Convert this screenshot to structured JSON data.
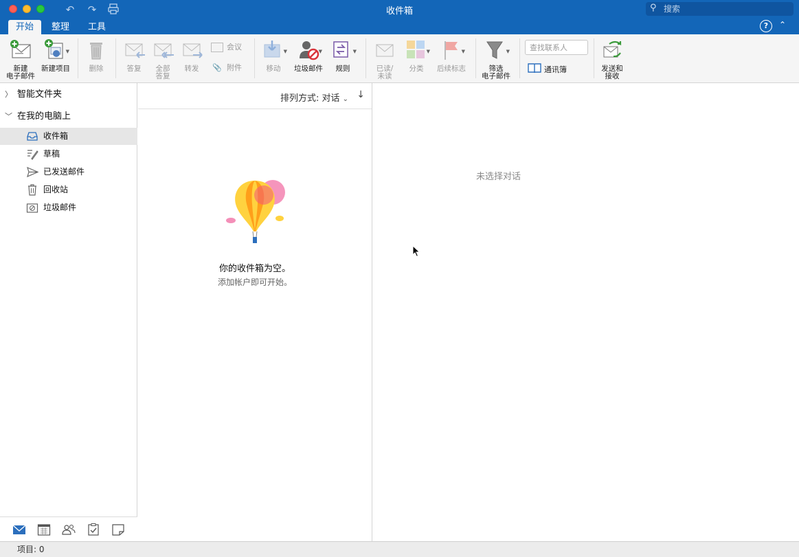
{
  "window": {
    "title": "收件箱",
    "search_placeholder": "搜索"
  },
  "tabs": [
    {
      "label": "开始",
      "active": true
    },
    {
      "label": "整理",
      "active": false
    },
    {
      "label": "工具",
      "active": false
    }
  ],
  "ribbon": {
    "new_email": {
      "line1": "新建",
      "line2": "电子邮件"
    },
    "new_item": "新建项目",
    "delete": "删除",
    "reply": "答复",
    "reply_all": {
      "line1": "全部",
      "line2": "答复"
    },
    "forward": "转发",
    "meeting": "会议",
    "attachment": "附件",
    "move": "移动",
    "junk": "垃圾邮件",
    "rules": "规则",
    "read_unread": {
      "line1": "已读/",
      "line2": "未读"
    },
    "categorize": "分类",
    "follow_up": "后续标志",
    "filter": {
      "line1": "筛选",
      "line2": "电子邮件"
    },
    "find_contact_placeholder": "查找联系人",
    "address_book": "通讯簿",
    "send_receive": {
      "line1": "发送和",
      "line2": "接收"
    }
  },
  "sidebar": {
    "smart_folders": "智能文件夹",
    "on_my_computer": "在我的电脑上",
    "folders": [
      {
        "label": "收件箱",
        "icon": "inbox-icon",
        "selected": true
      },
      {
        "label": "草稿",
        "icon": "drafts-icon",
        "selected": false
      },
      {
        "label": "已发送邮件",
        "icon": "sent-icon",
        "selected": false
      },
      {
        "label": "回收站",
        "icon": "trash-icon",
        "selected": false
      },
      {
        "label": "垃圾邮件",
        "icon": "junk-folder-icon",
        "selected": false
      }
    ],
    "bottom_nav": [
      "mail-icon",
      "calendar-icon",
      "people-icon",
      "tasks-icon",
      "notes-icon"
    ]
  },
  "message_list": {
    "sort_label": "排列方式: 对话",
    "sort_direction": "↓",
    "empty_title": "你的收件箱为空。",
    "empty_subtitle": "添加帐户即可开始。"
  },
  "reading_pane": {
    "no_selection": "未选择对话"
  },
  "status": {
    "items": "项目: 0"
  },
  "colors": {
    "accent": "#1366b8",
    "ribbon_bg": "#f5f5f5",
    "selected_folder": "#e6e6e6"
  }
}
